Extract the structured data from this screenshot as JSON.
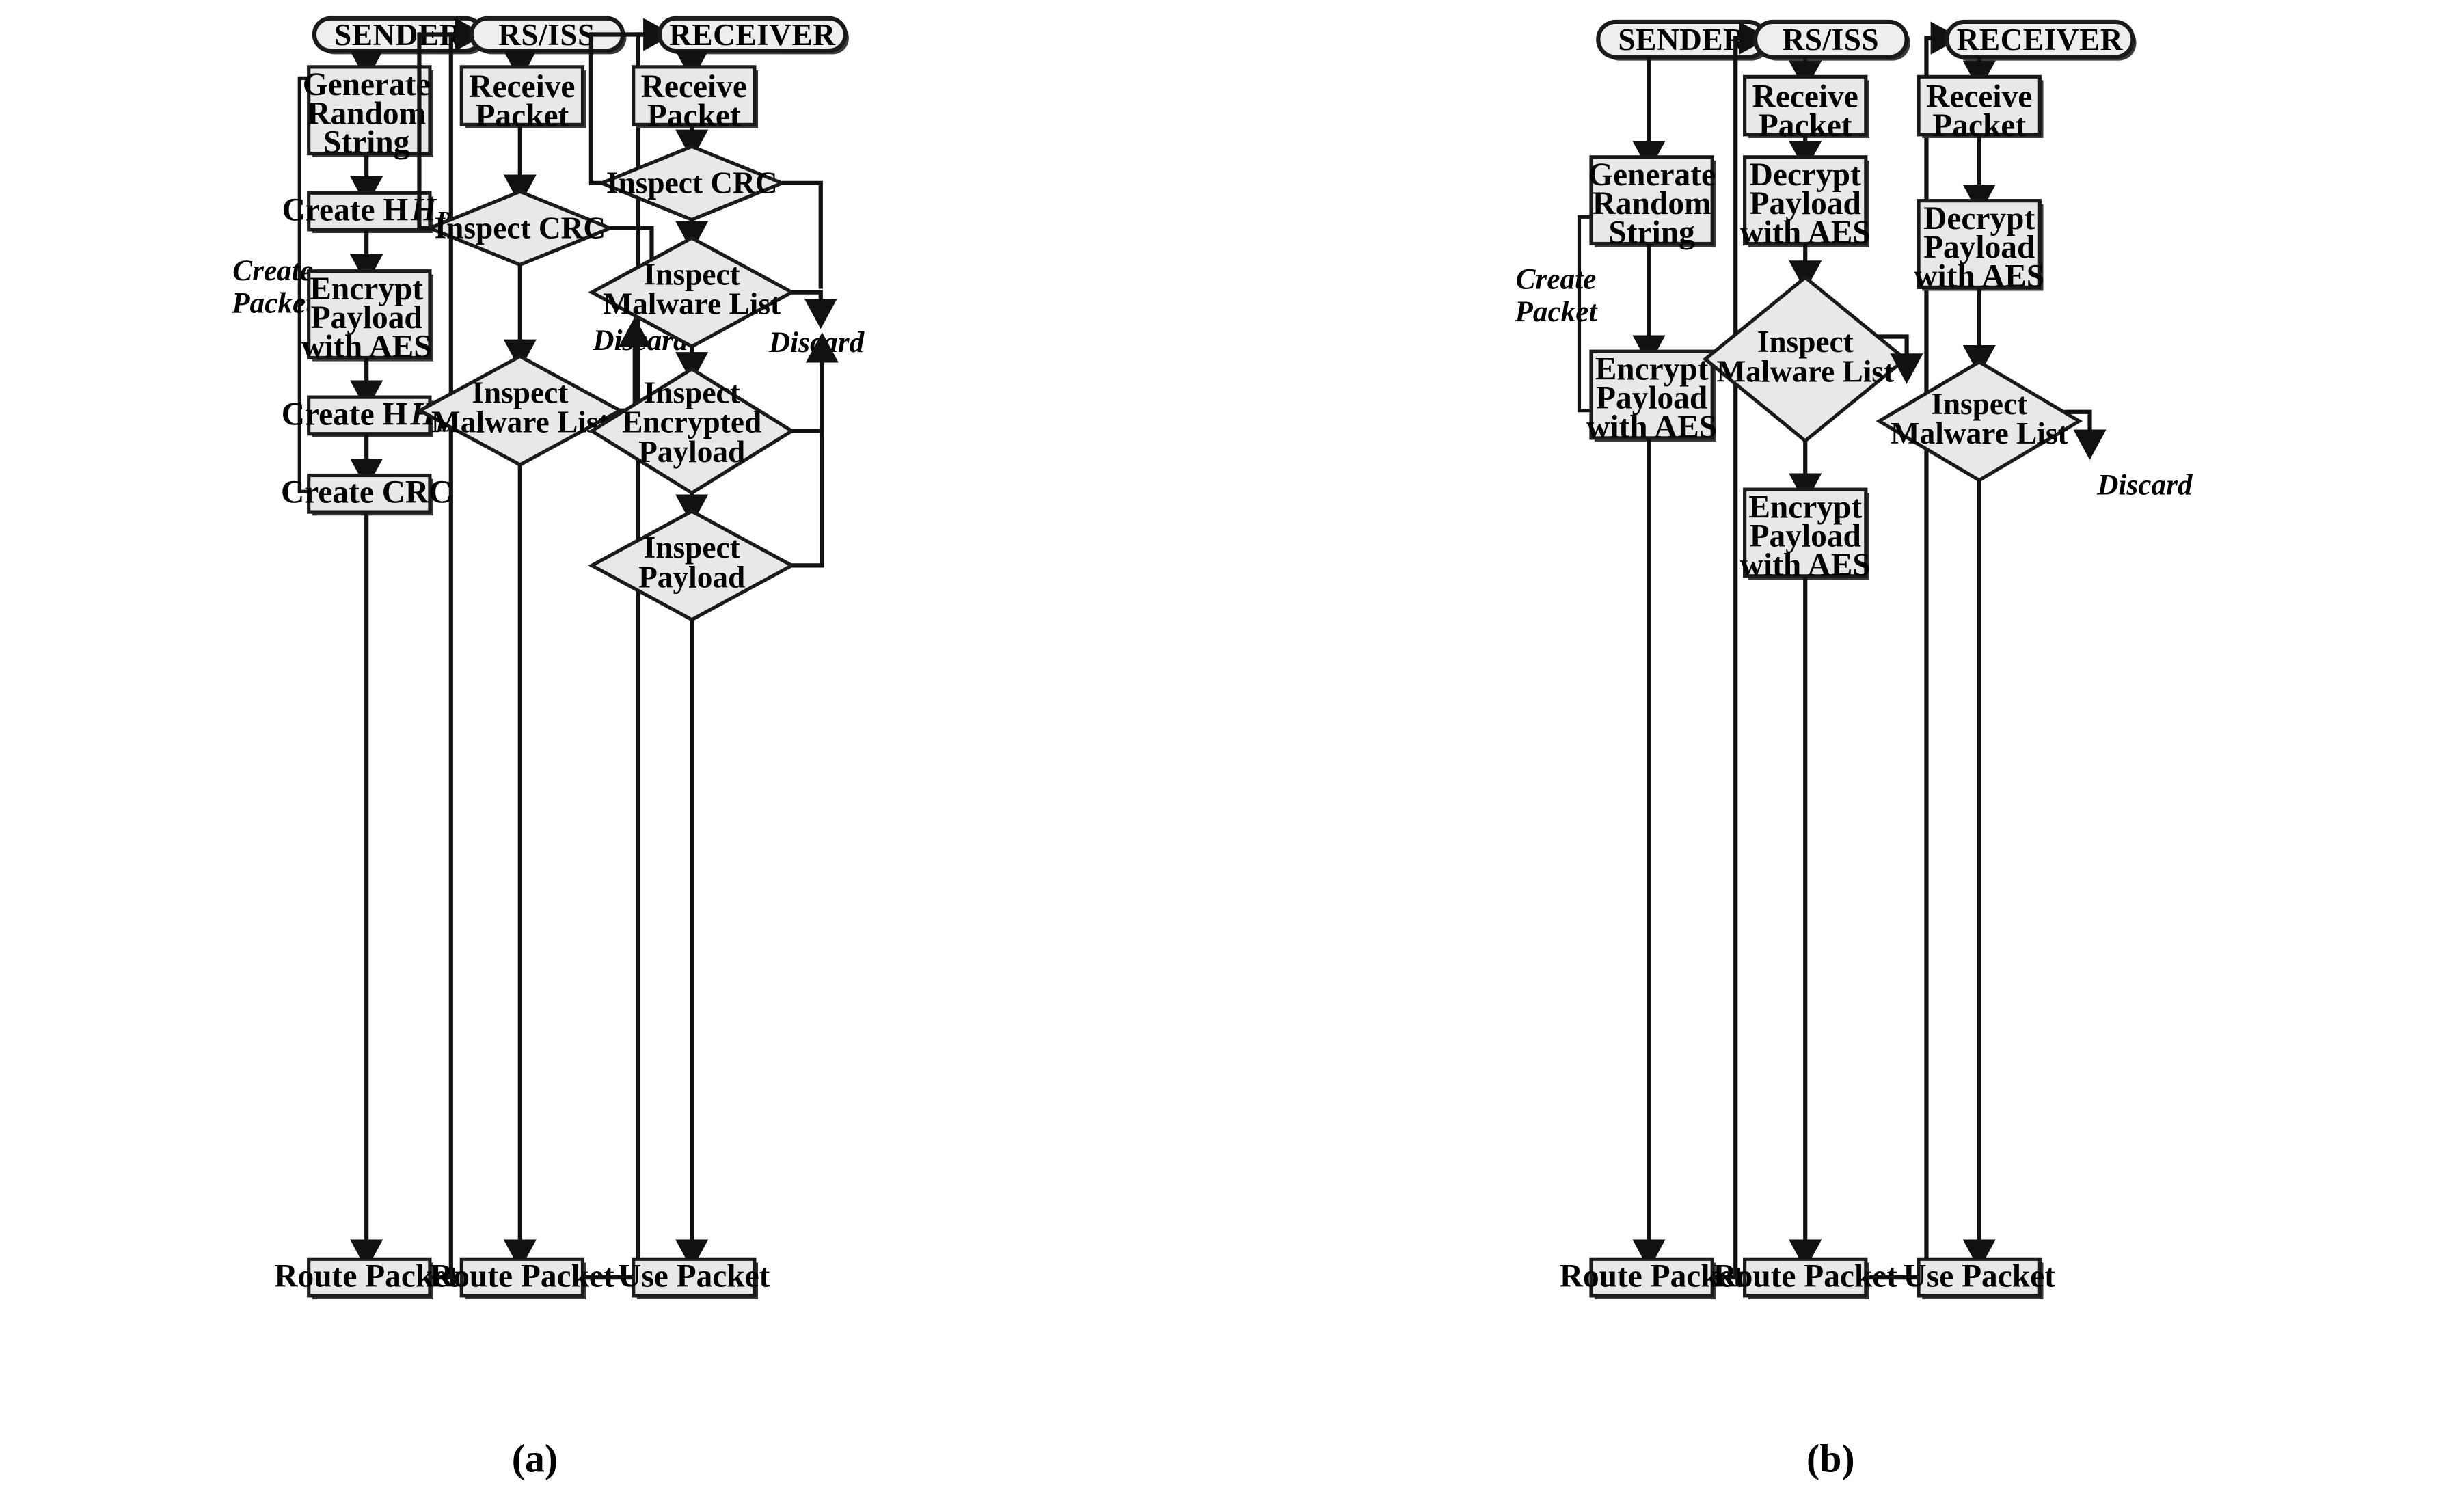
{
  "figure": {
    "caption_a": "(a)",
    "caption_b": "(b)",
    "accent": "#e8e8e8",
    "line_color": "#111111"
  },
  "chart_data": {
    "type": "diagram",
    "title": "Packet handling flowcharts (a) and (b)",
    "panels": [
      {
        "id": "a",
        "caption": "(a)",
        "lanes": [
          {
            "id": "a-sender",
            "terminal": "SENDER",
            "group_label": "Create Packet",
            "nodes": [
              {
                "kind": "process",
                "label": "Generate Random String"
              },
              {
                "kind": "process",
                "label": "Create H_P",
                "text": "Create H",
                "sub": "P"
              },
              {
                "kind": "process",
                "label": "Encrypt Payload with AES"
              },
              {
                "kind": "process",
                "label": "Create H_E",
                "text": "Create H",
                "sub": "E"
              },
              {
                "kind": "process",
                "label": "Create CRC"
              },
              {
                "kind": "process",
                "label": "Route Packet"
              }
            ]
          },
          {
            "id": "a-rsiss",
            "terminal": "RS/ISS",
            "nodes": [
              {
                "kind": "process",
                "label": "Receive Packet"
              },
              {
                "kind": "decision",
                "label": "Inspect CRC",
                "reject": "Discard"
              },
              {
                "kind": "decision",
                "label": "Inspect Malware List",
                "reject": "Discard"
              },
              {
                "kind": "process",
                "label": "Route Packet"
              }
            ]
          },
          {
            "id": "a-receiver",
            "terminal": "RECEIVER",
            "nodes": [
              {
                "kind": "process",
                "label": "Receive Packet"
              },
              {
                "kind": "decision",
                "label": "Inspect CRC",
                "reject": "Discard"
              },
              {
                "kind": "decision",
                "label": "Inspect Malware List",
                "reject": "Discard"
              },
              {
                "kind": "decision",
                "label": "Inspect Encrypted Payload",
                "reject": "Discard"
              },
              {
                "kind": "decision",
                "label": "Inspect Payload",
                "reject": "Discard"
              },
              {
                "kind": "process",
                "label": "Use Packet"
              }
            ]
          }
        ]
      },
      {
        "id": "b",
        "caption": "(b)",
        "lanes": [
          {
            "id": "b-sender",
            "terminal": "SENDER",
            "group_label": "Create Packet",
            "nodes": [
              {
                "kind": "process",
                "label": "Generate Random String"
              },
              {
                "kind": "process",
                "label": "Encrypt Payload with AES"
              },
              {
                "kind": "process",
                "label": "Route Packet"
              }
            ]
          },
          {
            "id": "b-rsiss",
            "terminal": "RS/ISS",
            "nodes": [
              {
                "kind": "process",
                "label": "Receive Packet"
              },
              {
                "kind": "process",
                "label": "Decrypt Payload with AES"
              },
              {
                "kind": "decision",
                "label": "Inspect Malware List",
                "reject": "Discard"
              },
              {
                "kind": "process",
                "label": "Encrypt Payload with AES"
              },
              {
                "kind": "process",
                "label": "Route Packet"
              }
            ]
          },
          {
            "id": "b-receiver",
            "terminal": "RECEIVER",
            "nodes": [
              {
                "kind": "process",
                "label": "Receive Packet"
              },
              {
                "kind": "process",
                "label": "Decrypt Payload with AES"
              },
              {
                "kind": "decision",
                "label": "Inspect Malware List",
                "reject": "Discard"
              },
              {
                "kind": "process",
                "label": "Use Packet"
              }
            ]
          }
        ]
      }
    ]
  },
  "a": {
    "sender": {
      "terminal": "SENDER",
      "group_label_l1": "Create",
      "group_label_l2": "Packet",
      "n1_l1": "Generate",
      "n1_l2": "Random",
      "n1_l3": "String",
      "n2_text": "Create H",
      "n2_sub": "P",
      "n3_l1": "Encrypt",
      "n3_l2": "Payload",
      "n3_l3": "with AES",
      "n4_text": "Create H",
      "n4_sub": "E",
      "n5": "Create CRC",
      "n6": "Route Packet"
    },
    "rsiss": {
      "terminal": "RS/ISS",
      "n1_l1": "Receive",
      "n1_l2": "Packet",
      "d1": "Inspect CRC",
      "d2_l1": "Inspect",
      "d2_l2": "Malware List",
      "discard": "Discard",
      "n2": "Route Packet"
    },
    "receiver": {
      "terminal": "RECEIVER",
      "n1_l1": "Receive",
      "n1_l2": "Packet",
      "d1": "Inspect CRC",
      "d2_l1": "Inspect",
      "d2_l2": "Malware List",
      "d3_l1": "Inspect",
      "d3_l2": "Encrypted",
      "d3_l3": "Payload",
      "d4_l1": "Inspect",
      "d4_l2": "Payload",
      "discard_top": "Discard",
      "discard_bottom": "Discard",
      "n2": "Use Packet"
    },
    "caption": "(a)"
  },
  "b": {
    "sender": {
      "terminal": "SENDER",
      "group_label_l1": "Create",
      "group_label_l2": "Packet",
      "n1_l1": "Generate",
      "n1_l2": "Random",
      "n1_l3": "String",
      "n2_l1": "Encrypt",
      "n2_l2": "Payload",
      "n2_l3": "with AES",
      "n3": "Route Packet"
    },
    "rsiss": {
      "terminal": "RS/ISS",
      "n1_l1": "Receive",
      "n1_l2": "Packet",
      "n2_l1": "Decrypt",
      "n2_l2": "Payload",
      "n2_l3": "with AES",
      "d1_l1": "Inspect",
      "d1_l2": "Malware List",
      "discard": "Discard",
      "n3_l1": "Encrypt",
      "n3_l2": "Payload",
      "n3_l3": "with AES",
      "n4": "Route Packet"
    },
    "receiver": {
      "terminal": "RECEIVER",
      "n1_l1": "Receive",
      "n1_l2": "Packet",
      "n2_l1": "Decrypt",
      "n2_l2": "Payload",
      "n2_l3": "with AES",
      "d1_l1": "Inspect",
      "d1_l2": "Malware List",
      "discard": "Discard",
      "n3": "Use Packet"
    },
    "caption": "(b)"
  }
}
